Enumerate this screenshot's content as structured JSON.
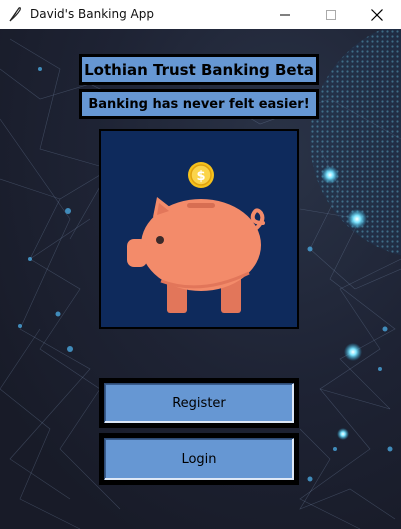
{
  "window": {
    "title": "David's Banking App"
  },
  "header": {
    "title": "Lothian Trust Banking Beta",
    "tagline": "Banking has never felt easier!"
  },
  "image": {
    "coin_symbol": "$"
  },
  "actions": {
    "register_label": "Register",
    "login_label": "Login"
  },
  "colors": {
    "accent": "#6697d3",
    "panel_bg": "#0e2a5c",
    "pig": "#f38b6a",
    "coin": "#f6c21c",
    "background": "#1d2030"
  },
  "icons": {
    "app": "feather-icon",
    "minimize": "minimize-icon",
    "maximize": "maximize-icon",
    "close": "close-icon"
  }
}
